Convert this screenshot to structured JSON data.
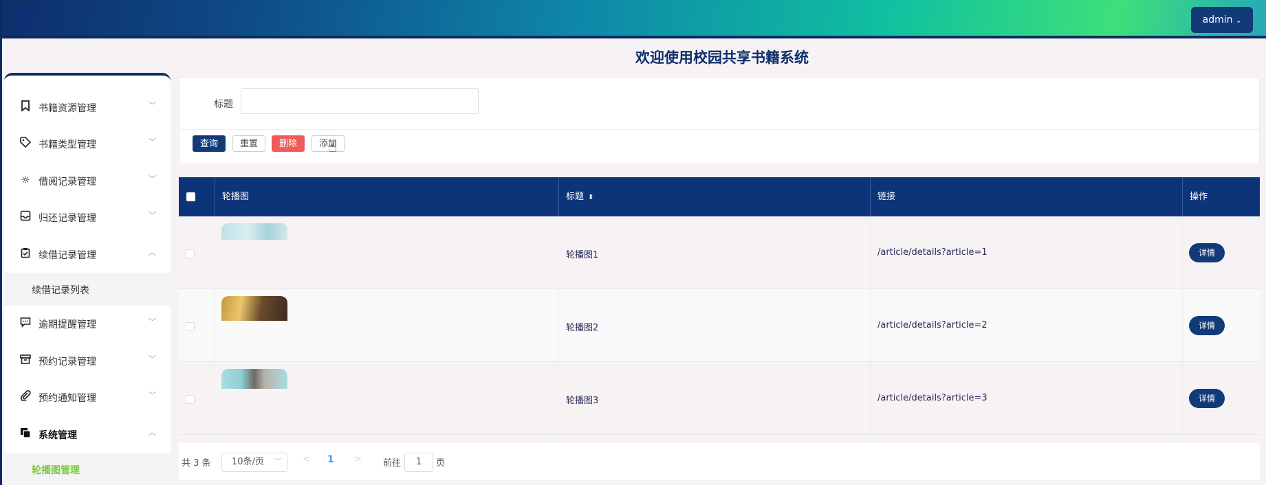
{
  "header": {
    "user_label": "admin",
    "page_title": "欢迎使用校园共享书籍系统"
  },
  "sidebar": {
    "items": [
      {
        "label": "书籍资源管理",
        "icon": "bookmark-icon"
      },
      {
        "label": "书籍类型管理",
        "icon": "tag-icon"
      },
      {
        "label": "借阅记录管理",
        "icon": "sun-icon"
      },
      {
        "label": "归还记录管理",
        "icon": "inbox-icon"
      },
      {
        "label": "续借记录管理",
        "icon": "clipboard-check-icon"
      },
      {
        "label": "续借记录列表",
        "icon": ""
      },
      {
        "label": "逾期提醒管理",
        "icon": "message-icon"
      },
      {
        "label": "预约记录管理",
        "icon": "archive-icon"
      },
      {
        "label": "预约通知管理",
        "icon": "paperclip-icon"
      },
      {
        "label": "系统管理",
        "icon": "copy-icon"
      },
      {
        "label": "轮播图管理",
        "icon": ""
      }
    ]
  },
  "search": {
    "title_label": "标题",
    "title_value": "",
    "query_label": "查询",
    "reset_label": "重置",
    "delete_label": "删除",
    "add_label": "添加"
  },
  "table": {
    "headers": [
      "轮播图",
      "标题",
      "链接",
      "操作"
    ],
    "rows": [
      {
        "title": "轮播图1",
        "link": "/article/details?article=1",
        "action": "详情"
      },
      {
        "title": "轮播图2",
        "link": "/article/details?article=2",
        "action": "详情"
      },
      {
        "title": "轮播图3",
        "link": "/article/details?article=3",
        "action": "详情"
      }
    ]
  },
  "pagination": {
    "total": "共 3 条",
    "page_size": "10条/页",
    "current_page": "1",
    "goto_label": "前往",
    "goto_value": "1",
    "page_suffix": "页"
  },
  "colors": {
    "primary": "#123a78",
    "danger": "#ef5b5b",
    "active_menu": "#7ac943",
    "link_page": "#409eff"
  }
}
